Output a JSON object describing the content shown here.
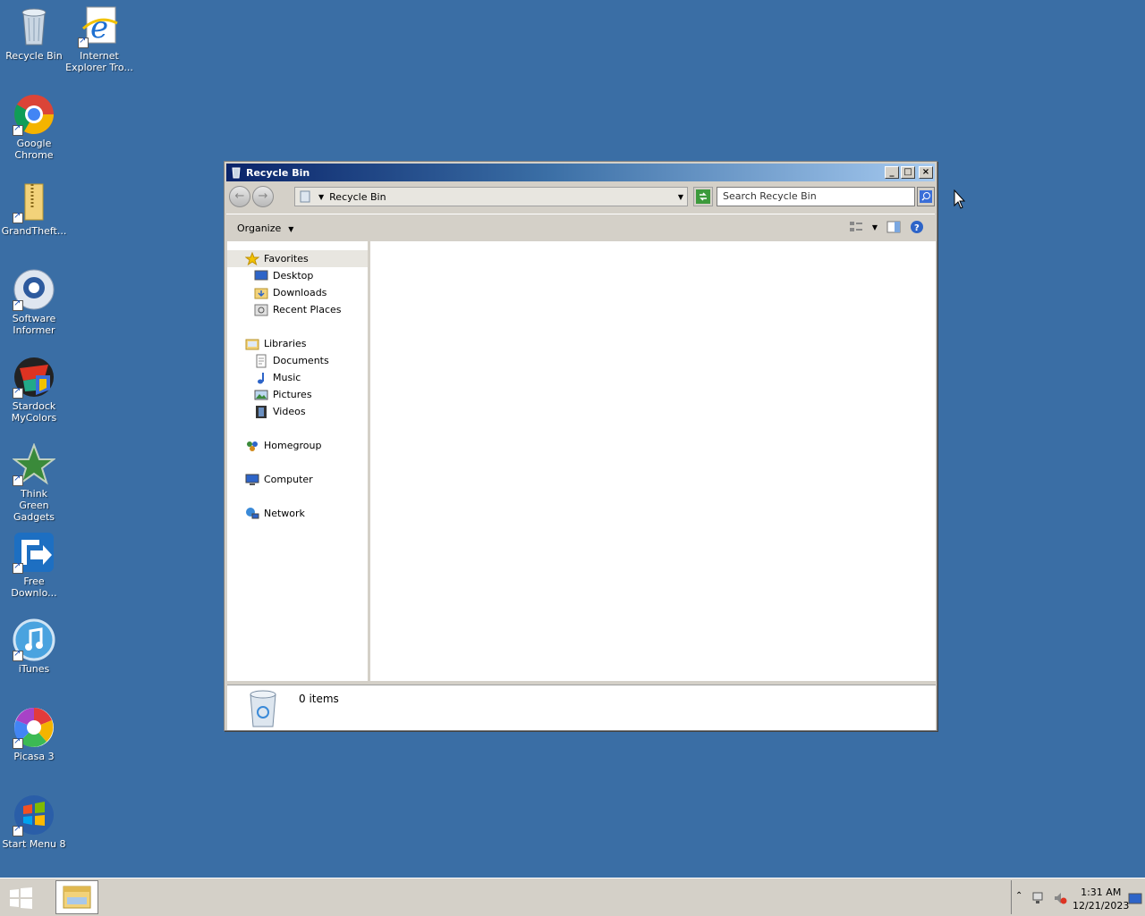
{
  "desktop": {
    "icons": [
      {
        "label": "Recycle Bin",
        "icon": "recycle-bin-icon"
      },
      {
        "label": "Internet Explorer Tro...",
        "icon": "internet-explorer-icon"
      },
      {
        "label": "Google Chrome",
        "icon": "chrome-icon"
      },
      {
        "label": "GrandTheft...",
        "icon": "zip-folder-icon"
      },
      {
        "label": "Software Informer",
        "icon": "software-informer-icon"
      },
      {
        "label": "Stardock MyColors",
        "icon": "stardock-icon"
      },
      {
        "label": "Think Green Gadgets",
        "icon": "star-gadgets-icon"
      },
      {
        "label": "Free Downlo...",
        "icon": "free-download-icon"
      },
      {
        "label": "iTunes",
        "icon": "itunes-icon"
      },
      {
        "label": "Picasa 3",
        "icon": "picasa-icon"
      },
      {
        "label": "Start Menu 8",
        "icon": "start-menu-icon"
      }
    ]
  },
  "window": {
    "title": "Recycle Bin",
    "address": "Recycle Bin",
    "search_placeholder": "Search Recycle Bin",
    "organize_label": "Organize",
    "nav": {
      "favorites": "Favorites",
      "desktop": "Desktop",
      "downloads": "Downloads",
      "recent": "Recent Places",
      "libraries": "Libraries",
      "documents": "Documents",
      "music": "Music",
      "pictures": "Pictures",
      "videos": "Videos",
      "homegroup": "Homegroup",
      "computer": "Computer",
      "network": "Network"
    },
    "status": "0 items"
  },
  "taskbar": {
    "time": "1:31 AM",
    "date": "12/21/2023"
  },
  "colors": {
    "desktop": "#3a6ea5",
    "title_start": "#0a246a",
    "title_end": "#a6caf0"
  }
}
